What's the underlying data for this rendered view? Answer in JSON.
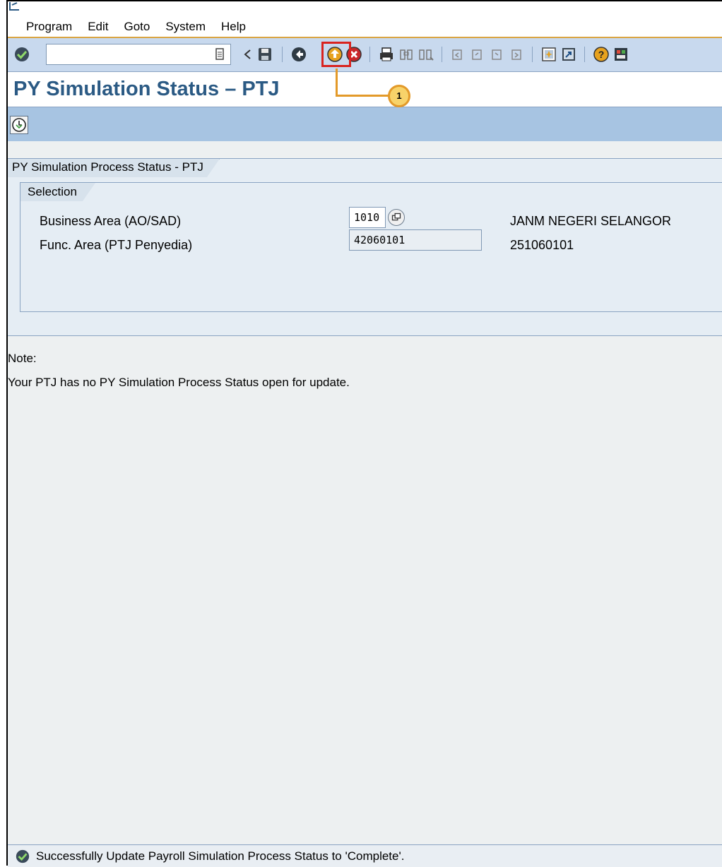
{
  "menu": {
    "items": [
      {
        "label": "Program"
      },
      {
        "label": "Edit"
      },
      {
        "label": "Goto"
      },
      {
        "label": "System"
      },
      {
        "label": "Help"
      }
    ]
  },
  "toolbar": {
    "command_field_value": "",
    "icons": [
      "enter-icon",
      "command-dropdown-icon",
      "back-arrow-small-icon",
      "save-icon",
      "back-icon",
      "exit-icon",
      "cancel-icon",
      "print-icon",
      "find-icon",
      "find-next-icon",
      "first-page-icon",
      "previous-page-icon",
      "next-page-icon",
      "last-page-icon",
      "create-session-icon",
      "shortcut-icon",
      "help-icon",
      "customize-layout-icon"
    ],
    "callout_number": "1"
  },
  "header": {
    "title": "PY Simulation Status – PTJ"
  },
  "app_toolbar": {
    "icons": [
      "execute-icon"
    ]
  },
  "main": {
    "group_title": "PY Simulation Process Status - PTJ",
    "selection": {
      "title": "Selection",
      "fields": [
        {
          "label": "Business Area (AO/SAD)",
          "value": "1010",
          "description": "JANM NEGERI SELANGOR"
        },
        {
          "label": "Func. Area (PTJ Penyedia)",
          "value": "42060101",
          "description": "251060101"
        }
      ]
    },
    "note_label": "Note:",
    "note_text": "Your PTJ has no PY Simulation Process Status open for update."
  },
  "status": {
    "message": "Successfully Update Payroll Simulation Process Status to 'Complete'.",
    "type": "success",
    "color": "#2e8b3a"
  }
}
